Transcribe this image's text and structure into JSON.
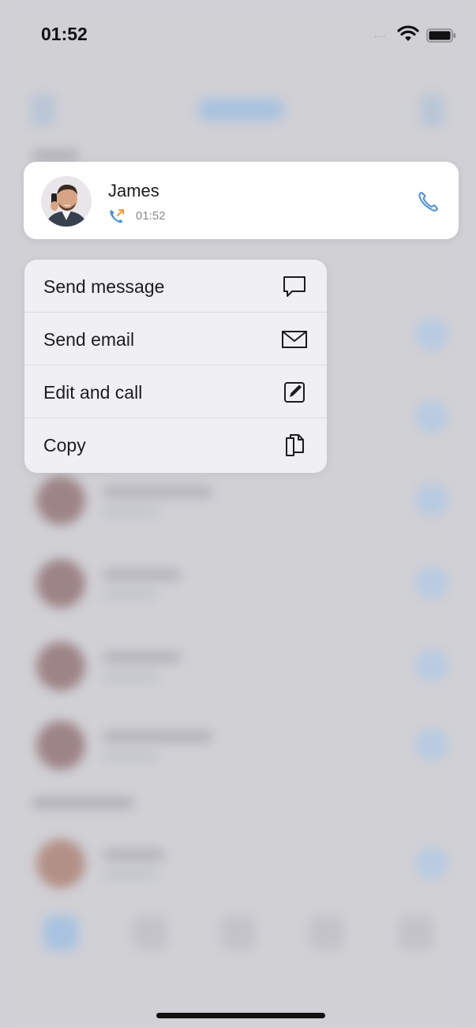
{
  "status_bar": {
    "time": "01:52",
    "signal": "....",
    "wifi_icon": "wifi-icon",
    "battery_icon": "battery-icon"
  },
  "contact_card": {
    "name": "James",
    "call_time": "01:52",
    "call_direction_icon": "outgoing-call-icon",
    "call_icon": "phone-icon",
    "accent_color": "#4a90d9",
    "call_direction_color": "#f29a3a"
  },
  "menu": {
    "items": [
      {
        "label": "Send message",
        "icon": "message-bubble-icon"
      },
      {
        "label": "Send email",
        "icon": "envelope-icon"
      },
      {
        "label": "Edit and call",
        "icon": "edit-icon"
      },
      {
        "label": "Copy",
        "icon": "copy-icon"
      }
    ]
  }
}
